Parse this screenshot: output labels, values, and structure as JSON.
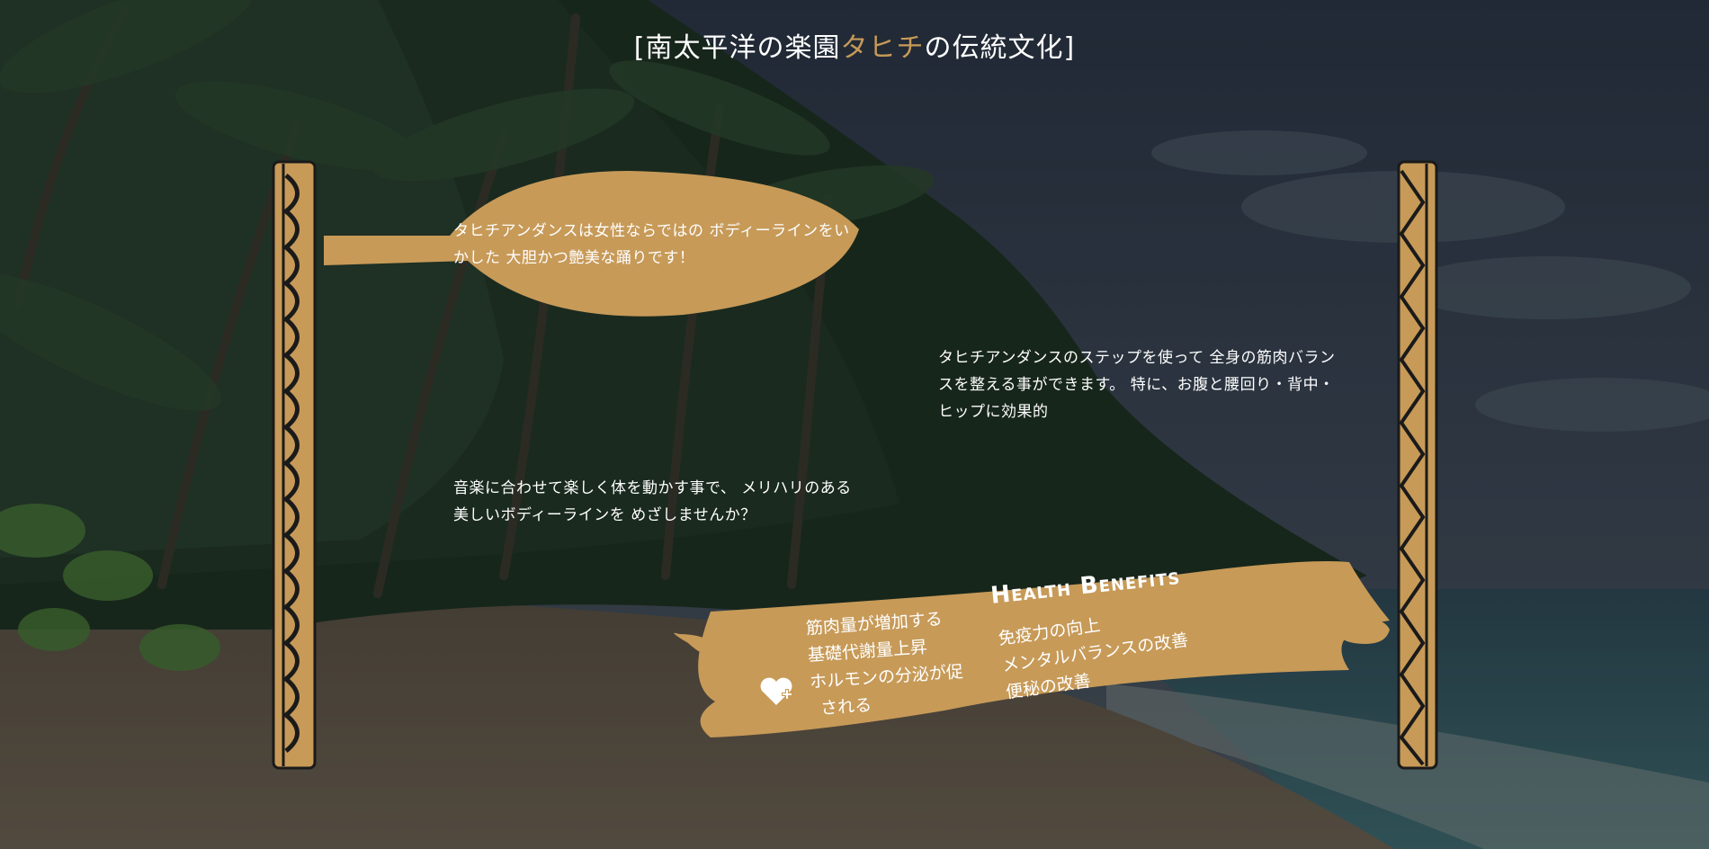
{
  "page": {
    "title_open": "[南太平洋の楽園",
    "title_accent": "タヒチ",
    "title_close": "の伝統文化]",
    "accent_color": "#c79a58",
    "paddle_color": "#c79a58"
  },
  "intro": {
    "paddle_text_1": "タヒチアンダンスは女性ならではの ボディーラインをいかした 大胆かつ艶美な踊りです！",
    "paddle_text_2": "タヒチアンダンスのステップを使って 全身の筋肉バランスを整える事ができます。 特に、お腹と腰回り・背中・ヒップに効果的",
    "paddle_text_3": "音楽に合わせて楽しく体を動かす事で、 メリハリのある美しいボディーラインを めざしませんか？"
  },
  "benefits": {
    "heading": "Health Benefits",
    "icon": "heart-plus-icon",
    "left": [
      "筋肉量が増加する",
      "基礎代謝量上昇",
      "ホルモンの分泌が促",
      "される"
    ],
    "right": [
      "免疫力の向上",
      "メンタルバランスの改善",
      "便秘の改善"
    ]
  }
}
